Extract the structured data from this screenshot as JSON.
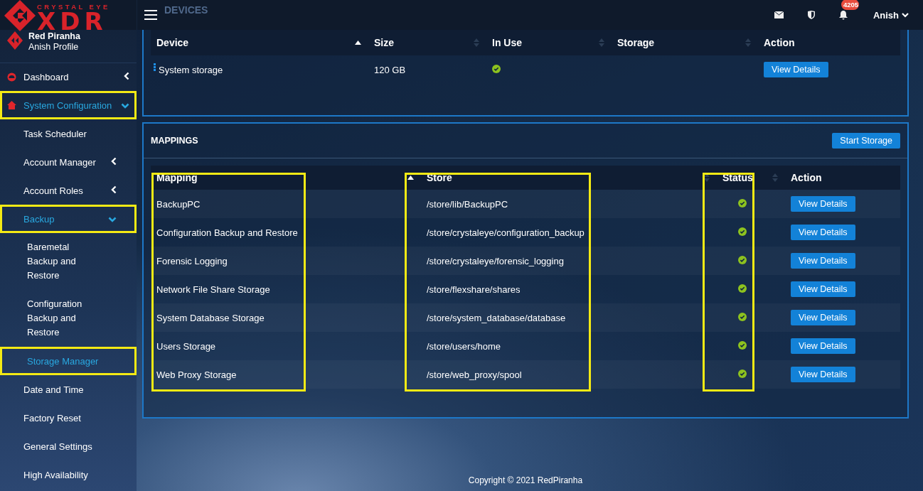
{
  "header": {
    "logo": {
      "tagline": "CRYSTAL EYE",
      "wordmark": "XDR"
    },
    "page_title": "DEVICES",
    "notification_badge": "4205",
    "user": "Anish"
  },
  "profile": {
    "company": "Red Piranha",
    "name": "Anish Profile"
  },
  "sidebar": {
    "items": [
      {
        "label": "Dashboard",
        "expanded": false,
        "selected": false,
        "highlighted": false
      },
      {
        "label": "System Configuration",
        "expanded": true,
        "selected": true,
        "highlighted": true,
        "children": [
          {
            "label": "Task Scheduler",
            "selected": false,
            "highlighted": false
          },
          {
            "label": "Account Manager",
            "expanded": false,
            "selected": false,
            "highlighted": false
          },
          {
            "label": "Account Roles",
            "expanded": false,
            "selected": false,
            "highlighted": false
          },
          {
            "label": "Backup",
            "expanded": true,
            "selected": true,
            "highlighted": true,
            "children": [
              {
                "label": "Baremetal Backup and Restore",
                "selected": false,
                "highlighted": false
              },
              {
                "label": "Configuration Backup and Restore",
                "selected": false,
                "highlighted": false
              },
              {
                "label": "Storage Manager",
                "selected": true,
                "highlighted": true
              }
            ]
          },
          {
            "label": "Date and Time",
            "selected": false,
            "highlighted": false
          },
          {
            "label": "Factory Reset",
            "selected": false,
            "highlighted": false
          },
          {
            "label": "General Settings",
            "selected": false,
            "highlighted": false
          },
          {
            "label": "High Availability",
            "selected": false,
            "highlighted": false
          }
        ]
      }
    ]
  },
  "devices": {
    "columns": [
      {
        "label": "Device",
        "sorted": true
      },
      {
        "label": "Size",
        "sorted": false
      },
      {
        "label": "In Use",
        "sorted": false
      },
      {
        "label": "Storage",
        "sorted": false
      },
      {
        "label": "Action"
      }
    ],
    "rows": [
      {
        "device": "System storage",
        "size": "120 GB",
        "in_use": true,
        "action": "View Details"
      }
    ]
  },
  "mappings": {
    "title": "MAPPINGS",
    "button": "Start Storage",
    "columns": [
      {
        "label": "Mapping",
        "sorted": true,
        "highlighted": true
      },
      {
        "label": "Store",
        "sorted": false,
        "highlighted": true
      },
      {
        "label": "Status",
        "sorted": false,
        "highlighted": true
      },
      {
        "label": "Action"
      }
    ],
    "rows": [
      {
        "mapping": "BackupPC",
        "store": "/store/lib/BackupPC",
        "status": true,
        "action": "View Details"
      },
      {
        "mapping": "Configuration Backup and Restore",
        "store": "/store/crystaleye/configuration_backup",
        "status": true,
        "action": "View Details"
      },
      {
        "mapping": "Forensic Logging",
        "store": "/store/crystaleye/forensic_logging",
        "status": true,
        "action": "View Details"
      },
      {
        "mapping": "Network File Share Storage",
        "store": "/store/flexshare/shares",
        "status": true,
        "action": "View Details"
      },
      {
        "mapping": "System Database Storage",
        "store": "/store/system_database/database",
        "status": true,
        "action": "View Details"
      },
      {
        "mapping": "Users Storage",
        "store": "/store/users/home",
        "status": true,
        "action": "View Details"
      },
      {
        "mapping": "Web Proxy Storage",
        "store": "/store/web_proxy/spool",
        "status": true,
        "action": "View Details"
      }
    ]
  },
  "footer": "Copyright © 2021 RedPiranha"
}
